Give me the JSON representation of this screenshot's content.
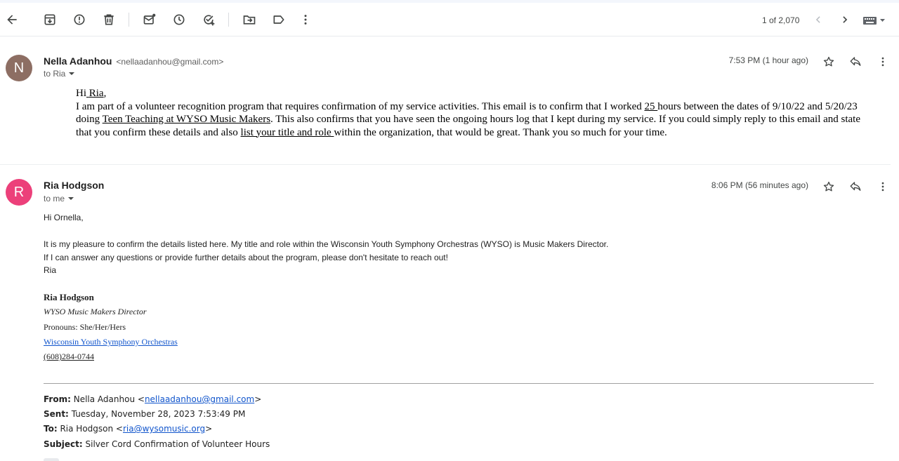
{
  "toolbar": {
    "pager_text": "1 of 2,070"
  },
  "messages": [
    {
      "avatar_letter": "N",
      "avatar_color": "#8d6e63",
      "sender_name": "Nella Adanhou",
      "sender_email": "<nellaadanhou@gmail.com>",
      "to_label": "to Ria",
      "time": "7:53 PM (1 hour ago)",
      "body": {
        "greeting_hi": "Hi",
        "greeting_name": "Ria",
        "greeting_comma": ",",
        "p1": "I am part of a volunteer recognition program that requires confirmation of my service activities. This email is to confirm that I worked",
        "hours": "25 ",
        "p2": "hours between the dates of 9/10/22 and 5/20/23",
        "p3": "doing",
        "program": "Teen Teaching at WYSO Music Makers",
        "p4": ". This also confirms that you have seen the ongoing hours log that I kept during my service. If you could simply reply to this email and state",
        "p5": "that you confirm these details and also",
        "list_link": "list your title and role ",
        "p6": "within the organization, that would be great. Thank you so much for your time."
      }
    },
    {
      "avatar_letter": "R",
      "avatar_color": "#ec407a",
      "sender_name": "Ria Hodgson",
      "to_label": "to me",
      "time": "8:06 PM (56 minutes ago)",
      "body": {
        "greeting": "Hi Ornella,",
        "line1": "It is my pleasure to confirm the details listed here.  My title and role within the Wisconsin Youth Symphony Orchestras (WYSO) is Music Makers Director.",
        "line2": "If I can answer any questions or provide further details about the program, please don't hesitate to reach out!",
        "line3": "Ria"
      },
      "signature": {
        "name": "Ria Hodgson",
        "title": "WYSO Music Makers Director",
        "pronouns": "Pronouns: She/Her/Hers",
        "org_link": "Wisconsin Youth Symphony Orchestras",
        "phone": "(608)284-0744"
      },
      "quoted": {
        "from_label": "From:",
        "from_name": "Nella Adanhou <",
        "from_email": "nellaadanhou@gmail.com",
        "from_close": ">",
        "sent_label": "Sent:",
        "sent_value": "Tuesday, November 28, 2023 7:53:49 PM",
        "to_label": "To:",
        "to_name": "Ria Hodgson <",
        "to_email": "ria@wysomusic.org",
        "to_close": ">",
        "subject_label": "Subject:",
        "subject_value": "Silver Cord Confirmation of Volunteer Hours"
      }
    }
  ]
}
